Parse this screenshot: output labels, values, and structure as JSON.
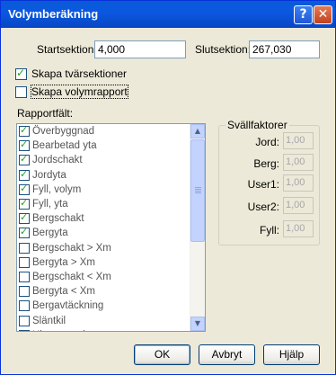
{
  "window": {
    "title": "Volymberäkning",
    "help_glyph": "?",
    "close_glyph": "✕"
  },
  "start": {
    "label": "Startsektion:",
    "value": "4,000"
  },
  "end": {
    "label": "Slutsektion:",
    "value": "267,030"
  },
  "options": [
    {
      "label": "Skapa tvärsektioner",
      "checked": true
    },
    {
      "label": "Skapa volymrapport",
      "checked": false
    }
  ],
  "report": {
    "label": "Rapportfält:",
    "items": [
      {
        "label": "Överbyggnad",
        "checked": true
      },
      {
        "label": "Bearbetad yta",
        "checked": true
      },
      {
        "label": "Jordschakt",
        "checked": true
      },
      {
        "label": "Jordyta",
        "checked": true
      },
      {
        "label": "Fyll, volym",
        "checked": true
      },
      {
        "label": "Fyll, yta",
        "checked": true
      },
      {
        "label": "Bergschakt",
        "checked": true
      },
      {
        "label": "Bergyta",
        "checked": true
      },
      {
        "label": "Bergschakt > Xm",
        "checked": false
      },
      {
        "label": "Bergyta > Xm",
        "checked": false
      },
      {
        "label": "Bergschakt < Xm",
        "checked": false
      },
      {
        "label": "Bergyta < Xm",
        "checked": false
      },
      {
        "label": "Bergavtäckning",
        "checked": false
      },
      {
        "label": "Släntkil",
        "checked": false
      },
      {
        "label": "Ultrastenering",
        "checked": false
      }
    ]
  },
  "swell": {
    "title": "Svällfaktorer",
    "rows": [
      {
        "label": "Jord:",
        "value": "1,00"
      },
      {
        "label": "Berg:",
        "value": "1,00"
      },
      {
        "label": "User1:",
        "value": "1,00"
      },
      {
        "label": "User2:",
        "value": "1,00"
      },
      {
        "label": "Fyll:",
        "value": "1,00"
      }
    ]
  },
  "buttons": {
    "ok": "OK",
    "cancel": "Avbryt",
    "help": "Hjälp"
  },
  "colors": {
    "titlebar": "#0a5bd6",
    "check": "#21a121",
    "face": "#ece9d8"
  }
}
